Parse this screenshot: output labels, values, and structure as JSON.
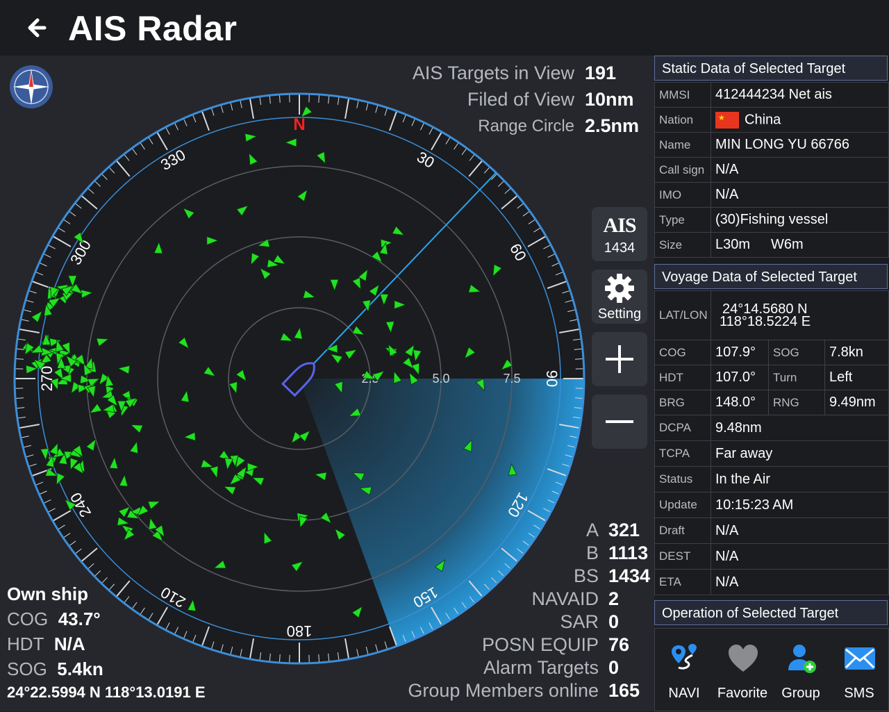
{
  "header": {
    "title": "AIS Radar"
  },
  "stats": {
    "targets_label": "AIS Targets in View",
    "targets_value": "191",
    "fov_label": "Filed of View",
    "fov_value": "10nm",
    "range_label": "Range Circle",
    "range_value": "2.5nm"
  },
  "radar": {
    "north_label": "N",
    "bearing_labels": [
      "30",
      "60",
      "90",
      "120",
      "150",
      "180",
      "210",
      "240",
      "270",
      "300",
      "330"
    ],
    "range_labels": [
      "2.5",
      "5.0",
      "7.5"
    ],
    "own_heading_deg": 43.7,
    "scan_start_deg": 90,
    "scan_end_deg": 160
  },
  "controls": {
    "ais_logo": "AIS",
    "ais_count": "1434",
    "setting_label": "Setting"
  },
  "own_ship": {
    "title": "Own ship",
    "cog_label": "COG",
    "cog_value": "43.7°",
    "hdt_label": "HDT",
    "hdt_value": "N/A",
    "sog_label": "SOG",
    "sog_value": "5.4kn",
    "position": "24°22.5994 N 118°13.0191 E"
  },
  "counts": [
    {
      "label": "A",
      "value": "321"
    },
    {
      "label": "B",
      "value": "1113"
    },
    {
      "label": "BS",
      "value": "1434"
    },
    {
      "label": "NAVAID",
      "value": "2"
    },
    {
      "label": "SAR",
      "value": "0"
    },
    {
      "label": "POSN EQUIP",
      "value": "76"
    },
    {
      "label": "Alarm Targets",
      "value": "0"
    },
    {
      "label": "Group Members online",
      "value": "165"
    }
  ],
  "static_panel": {
    "title": "Static Data of Selected Target",
    "rows": [
      {
        "k": "MMSI",
        "v": "412444234 Net ais"
      },
      {
        "k": "Nation",
        "v": "China"
      },
      {
        "k": "Name",
        "v": "MIN LONG YU 66766"
      },
      {
        "k": "Call sign",
        "v": "N/A"
      },
      {
        "k": "IMO",
        "v": "N/A"
      },
      {
        "k": "Type",
        "v": "(30)Fishing vessel"
      }
    ],
    "size_label": "Size",
    "size_length": "L30m",
    "size_width": "W6m"
  },
  "voyage_panel": {
    "title": "Voyage Data of Selected Target",
    "latlon_label": "LAT/LON",
    "lat": "24°14.5680 N",
    "lon": "118°18.5224  E",
    "cog_label": "COG",
    "cog": "107.9°",
    "sog_label": "SOG",
    "sog": "7.8kn",
    "hdt_label": "HDT",
    "hdt": "107.0°",
    "turn_label": "Turn",
    "turn": "Left",
    "brg_label": "BRG",
    "brg": "148.0°",
    "rng_label": "RNG",
    "rng": "9.49nm",
    "rows": [
      {
        "k": "DCPA",
        "v": "9.48nm"
      },
      {
        "k": "TCPA",
        "v": "Far away"
      },
      {
        "k": "Status",
        "v": "In the Air"
      },
      {
        "k": "Update",
        "v": "10:15:23 AM"
      },
      {
        "k": "Draft",
        "v": "N/A"
      },
      {
        "k": "DEST",
        "v": "N/A"
      },
      {
        "k": "ETA",
        "v": "N/A"
      }
    ]
  },
  "operation_panel": {
    "title": "Operation of Selected Target",
    "buttons": [
      "NAVI",
      "Favorite",
      "Group",
      "SMS"
    ]
  },
  "colors": {
    "target": "#22e022",
    "scan": "#2aa6ee",
    "ring": "#5a5d63",
    "bezel": "#3c8ed8",
    "accent": "#ff2020"
  }
}
